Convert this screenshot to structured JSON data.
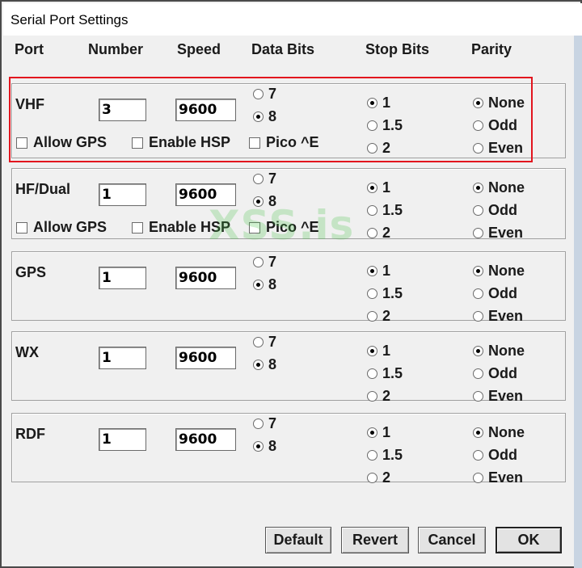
{
  "window": {
    "title": "Serial Port Settings"
  },
  "headers": {
    "port": "Port",
    "number": "Number",
    "speed": "Speed",
    "data_bits": "Data Bits",
    "stop_bits": "Stop Bits",
    "parity": "Parity"
  },
  "ports": [
    {
      "name": "VHF",
      "number": "3",
      "speed": "9600",
      "data_bits": [
        "7",
        "8"
      ],
      "data_bits_selected": "8",
      "stop_bits": [
        "1",
        "1.5",
        "2"
      ],
      "stop_bits_selected": "1",
      "parity": [
        "None",
        "Odd",
        "Even"
      ],
      "parity_selected": "None",
      "checkboxes": [
        "Allow GPS",
        "Enable HSP",
        "Pico ^E"
      ]
    },
    {
      "name": "HF/Dual",
      "number": "1",
      "speed": "9600",
      "data_bits": [
        "7",
        "8"
      ],
      "data_bits_selected": "8",
      "stop_bits": [
        "1",
        "1.5",
        "2"
      ],
      "stop_bits_selected": "1",
      "parity": [
        "None",
        "Odd",
        "Even"
      ],
      "parity_selected": "None",
      "checkboxes": [
        "Allow GPS",
        "Enable HSP",
        "Pico ^E"
      ]
    },
    {
      "name": "GPS",
      "number": "1",
      "speed": "9600",
      "data_bits": [
        "7",
        "8"
      ],
      "data_bits_selected": "8",
      "stop_bits": [
        "1",
        "1.5",
        "2"
      ],
      "stop_bits_selected": "1",
      "parity": [
        "None",
        "Odd",
        "Even"
      ],
      "parity_selected": "None"
    },
    {
      "name": "WX",
      "number": "1",
      "speed": "9600",
      "data_bits": [
        "7",
        "8"
      ],
      "data_bits_selected": "8",
      "stop_bits": [
        "1",
        "1.5",
        "2"
      ],
      "stop_bits_selected": "1",
      "parity": [
        "None",
        "Odd",
        "Even"
      ],
      "parity_selected": "None"
    },
    {
      "name": "RDF",
      "number": "1",
      "speed": "9600",
      "data_bits": [
        "7",
        "8"
      ],
      "data_bits_selected": "8",
      "stop_bits": [
        "1",
        "1.5",
        "2"
      ],
      "stop_bits_selected": "1",
      "parity": [
        "None",
        "Odd",
        "Even"
      ],
      "parity_selected": "None"
    }
  ],
  "buttons": {
    "default": "Default",
    "revert": "Revert",
    "cancel": "Cancel",
    "ok": "OK"
  },
  "watermark": "XSS.is",
  "colors": {
    "highlight": "#e2151e",
    "watermark": "#48c448",
    "dialog_bg": "#f0f0f0"
  }
}
